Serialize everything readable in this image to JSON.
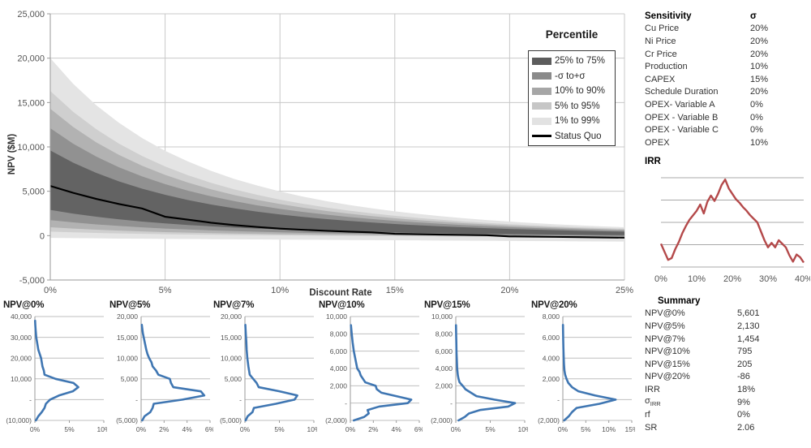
{
  "main_chart": {
    "ylabel": "NPV ($M)",
    "xlabel": "Discount Rate",
    "y_ticks": [
      "25,000",
      "20,000",
      "15,000",
      "10,000",
      "5,000",
      "0",
      "-5,000"
    ],
    "x_ticks": [
      "0%",
      "5%",
      "10%",
      "15%",
      "20%",
      "25%"
    ],
    "legend_title": "Percentile",
    "legend": [
      {
        "label": "25% to 75%",
        "color": "#5c5c5c",
        "type": "band"
      },
      {
        "label": "-σ to+σ",
        "color": "#8a8a8a",
        "type": "band"
      },
      {
        "label": "10% to 90%",
        "color": "#a6a6a6",
        "type": "band"
      },
      {
        "label": "5% to 95%",
        "color": "#c6c6c6",
        "type": "band"
      },
      {
        "label": "1% to 99%",
        "color": "#e2e2e2",
        "type": "band"
      },
      {
        "label": "Status Quo",
        "color": "#000000",
        "type": "line"
      }
    ]
  },
  "chart_data": [
    {
      "type": "area",
      "id": "npv-fan-chart",
      "title": "",
      "xlabel": "Discount Rate",
      "ylabel": "NPV ($M)",
      "xlim": [
        0,
        25
      ],
      "ylim": [
        -5000,
        25000
      ],
      "grid": true,
      "legend_position": "top-right",
      "x": [
        0,
        1,
        2,
        3,
        4,
        5,
        6,
        7,
        8,
        9,
        10,
        11,
        12,
        13,
        14,
        15,
        16,
        17,
        18,
        19,
        20,
        21,
        22,
        23,
        24,
        25
      ],
      "series": [
        {
          "name": "Status Quo",
          "values": [
            5601,
            4820,
            4140,
            3560,
            3060,
            2130,
            1800,
            1454,
            1190,
            980,
            795,
            660,
            545,
            450,
            370,
            205,
            160,
            120,
            85,
            50,
            -86,
            -110,
            -140,
            -170,
            -200,
            -230
          ]
        },
        {
          "name": "99%",
          "values": [
            20000,
            17100,
            14700,
            12700,
            11000,
            9550,
            8350,
            7300,
            6400,
            5650,
            4980,
            4400,
            3900,
            3460,
            3080,
            2740,
            2450,
            2190,
            1960,
            1760,
            1580,
            1420,
            1280,
            1160,
            1050,
            950
          ]
        },
        {
          "name": "95%",
          "values": [
            16300,
            13950,
            12000,
            10350,
            8970,
            7790,
            6800,
            5950,
            5220,
            4600,
            4060,
            3590,
            3180,
            2820,
            2510,
            2240,
            2000,
            1790,
            1600,
            1440,
            1290,
            1160,
            1050,
            950,
            860,
            780
          ]
        },
        {
          "name": "90%",
          "values": [
            14300,
            12240,
            10520,
            9080,
            7870,
            6840,
            5970,
            5220,
            4580,
            4030,
            3560,
            3150,
            2790,
            2480,
            2200,
            1960,
            1750,
            1570,
            1400,
            1260,
            1130,
            1020,
            920,
            830,
            750,
            680
          ]
        },
        {
          "name": "+sigma",
          "values": [
            12100,
            10360,
            8910,
            7690,
            6670,
            5800,
            5060,
            4430,
            3890,
            3420,
            3020,
            2670,
            2370,
            2100,
            1870,
            1660,
            1490,
            1330,
            1190,
            1070,
            960,
            860,
            780,
            700,
            630,
            570
          ]
        },
        {
          "name": "75%",
          "values": [
            9600,
            8220,
            7070,
            6100,
            5290,
            4600,
            4010,
            3510,
            3080,
            2710,
            2390,
            2110,
            1870,
            1660,
            1480,
            1310,
            1170,
            1050,
            940,
            840,
            750,
            680,
            610,
            550,
            490,
            440
          ]
        },
        {
          "name": "25%",
          "values": [
            2900,
            2480,
            2130,
            1840,
            1590,
            1380,
            1200,
            1050,
            910,
            800,
            700,
            610,
            540,
            470,
            410,
            360,
            310,
            270,
            230,
            200,
            170,
            140,
            110,
            90,
            70,
            50
          ]
        },
        {
          "name": "-sigma",
          "values": [
            1750,
            1490,
            1270,
            1090,
            930,
            800,
            690,
            590,
            510,
            440,
            370,
            320,
            270,
            230,
            190,
            160,
            130,
            100,
            80,
            60,
            40,
            20,
            0,
            -20,
            -40,
            -60
          ]
        },
        {
          "name": "10%",
          "values": [
            950,
            800,
            670,
            570,
            480,
            400,
            340,
            280,
            240,
            200,
            160,
            130,
            100,
            80,
            55,
            35,
            15,
            0,
            -15,
            -30,
            -45,
            -60,
            -75,
            -90,
            -105,
            -120
          ]
        },
        {
          "name": "5%",
          "values": [
            450,
            370,
            300,
            250,
            200,
            160,
            125,
            95,
            70,
            45,
            25,
            5,
            -10,
            -30,
            -45,
            -60,
            -75,
            -90,
            -105,
            -120,
            -135,
            -150,
            -165,
            -180,
            -195,
            -210
          ]
        },
        {
          "name": "1%",
          "values": [
            -250,
            -280,
            -305,
            -330,
            -350,
            -370,
            -385,
            -400,
            -415,
            -430,
            -445,
            -460,
            -475,
            -490,
            -505,
            -520,
            -535,
            -550,
            -565,
            -580,
            -595,
            -610,
            -625,
            -640,
            -655,
            -670
          ]
        }
      ]
    },
    {
      "type": "line",
      "id": "irr-distribution",
      "title": "IRR",
      "xlabel": "",
      "ylabel": "",
      "xlim": [
        0,
        40
      ],
      "ylim": [
        0,
        1
      ],
      "grid": true,
      "x_ticks": [
        "0%",
        "10%",
        "20%",
        "30%",
        "40%"
      ],
      "color": "#b4494a",
      "x": [
        0,
        1,
        2,
        3,
        4,
        5,
        6,
        7,
        8,
        9,
        10,
        11,
        12,
        13,
        14,
        15,
        16,
        17,
        18,
        19,
        20,
        21,
        22,
        23,
        24,
        25,
        26,
        27,
        28,
        29,
        30,
        31,
        32,
        33,
        34,
        35,
        36,
        37,
        38,
        39,
        40
      ],
      "values": [
        0.26,
        0.17,
        0.08,
        0.1,
        0.2,
        0.28,
        0.38,
        0.46,
        0.53,
        0.58,
        0.63,
        0.7,
        0.6,
        0.73,
        0.8,
        0.74,
        0.82,
        0.92,
        0.98,
        0.88,
        0.82,
        0.76,
        0.72,
        0.67,
        0.63,
        0.58,
        0.54,
        0.5,
        0.4,
        0.3,
        0.22,
        0.27,
        0.22,
        0.3,
        0.26,
        0.22,
        0.13,
        0.06,
        0.14,
        0.11,
        0.05
      ]
    },
    {
      "type": "line",
      "id": "npv-at-0-histogram",
      "title": "NPV@0%",
      "orientation": "horizontal",
      "x_ticks": [
        "0%",
        "5%",
        "10%"
      ],
      "y_ticks": [
        "40,000",
        "30,000",
        "20,000",
        "10,000",
        "-",
        "(10,000)"
      ],
      "xlim": [
        0,
        10
      ],
      "ylim": [
        -10000,
        40000
      ],
      "color": "#3f76b2",
      "bins": [
        -10000,
        -8000,
        -6000,
        -4000,
        -2000,
        0,
        2000,
        4000,
        6000,
        8000,
        10000,
        12000,
        14000,
        16000,
        18000,
        20000,
        22000,
        24000,
        26000,
        28000,
        30000,
        32000,
        34000,
        36000,
        38000
      ],
      "freq": [
        0.15,
        0.5,
        1.0,
        1.4,
        1.6,
        2.2,
        3.5,
        5.5,
        6.3,
        5.6,
        3.0,
        1.4,
        1.3,
        1.1,
        1.0,
        0.9,
        0.7,
        0.5,
        0.4,
        0.3,
        0.2,
        0.15,
        0.1,
        0.06,
        0.03
      ]
    },
    {
      "type": "line",
      "id": "npv-at-5-histogram",
      "title": "NPV@5%",
      "orientation": "horizontal",
      "x_ticks": [
        "0%",
        "2%",
        "4%",
        "6%"
      ],
      "y_ticks": [
        "20,000",
        "15,000",
        "10,000",
        "5,000",
        "-",
        "(5,000)"
      ],
      "xlim": [
        0,
        6
      ],
      "ylim": [
        -5000,
        20000
      ],
      "color": "#3f76b2",
      "bins": [
        -5000,
        -4000,
        -3000,
        -2000,
        -1000,
        0,
        1000,
        2000,
        3000,
        4000,
        5000,
        6000,
        7000,
        8000,
        9000,
        10000,
        11000,
        12000,
        14000,
        16000,
        18000
      ],
      "freq": [
        0.1,
        0.3,
        0.8,
        1.0,
        1.1,
        3.6,
        5.5,
        5.2,
        2.8,
        2.6,
        2.5,
        1.5,
        1.3,
        1.0,
        0.9,
        0.7,
        0.55,
        0.45,
        0.3,
        0.15,
        0.06
      ]
    },
    {
      "type": "line",
      "id": "npv-at-7-histogram",
      "title": "NPV@7%",
      "orientation": "horizontal",
      "x_ticks": [
        "0%",
        "5%",
        "10%"
      ],
      "y_ticks": [
        "20,000",
        "15,000",
        "10,000",
        "5,000",
        "-",
        "(5,000)"
      ],
      "xlim": [
        0,
        10
      ],
      "ylim": [
        -5000,
        20000
      ],
      "color": "#3f76b2",
      "bins": [
        -5000,
        -4000,
        -3000,
        -2000,
        -1000,
        0,
        1000,
        2000,
        3000,
        4000,
        5000,
        6000,
        7000,
        8000,
        10000,
        12000,
        14000,
        16000,
        18000
      ],
      "freq": [
        0.1,
        0.4,
        1.1,
        1.3,
        4.5,
        7.2,
        7.6,
        5.0,
        2.0,
        1.7,
        1.2,
        0.7,
        0.6,
        0.5,
        0.35,
        0.25,
        0.2,
        0.12,
        0.06
      ]
    },
    {
      "type": "line",
      "id": "npv-at-10-histogram",
      "title": "NPV@10%",
      "orientation": "horizontal",
      "x_ticks": [
        "0%",
        "2%",
        "4%",
        "6%"
      ],
      "y_ticks": [
        "10,000",
        "8,000",
        "6,000",
        "4,000",
        "2,000",
        "-",
        "(2,000)"
      ],
      "xlim": [
        0,
        6
      ],
      "ylim": [
        -2000,
        10000
      ],
      "color": "#3f76b2",
      "bins": [
        -2000,
        -1600,
        -1200,
        -800,
        -400,
        0,
        400,
        800,
        1200,
        1600,
        2000,
        2400,
        2800,
        3200,
        3600,
        4000,
        5000,
        6000,
        7000,
        8000,
        9000
      ],
      "freq": [
        0.3,
        1.2,
        1.6,
        1.5,
        2.5,
        5.0,
        5.3,
        4.0,
        2.7,
        2.3,
        2.2,
        1.3,
        1.1,
        0.9,
        0.8,
        0.6,
        0.45,
        0.3,
        0.2,
        0.12,
        0.05
      ]
    },
    {
      "type": "line",
      "id": "npv-at-15-histogram",
      "title": "NPV@15%",
      "orientation": "horizontal",
      "x_ticks": [
        "0%",
        "5%",
        "10%"
      ],
      "y_ticks": [
        "10,000",
        "8,000",
        "6,000",
        "4,000",
        "2,000",
        "-",
        "(2,000)"
      ],
      "xlim": [
        0,
        10
      ],
      "ylim": [
        -2000,
        10000
      ],
      "color": "#3f76b2",
      "bins": [
        -2000,
        -1600,
        -1200,
        -800,
        -400,
        0,
        400,
        800,
        1200,
        1600,
        2000,
        2400,
        2800,
        3200,
        4000,
        5000,
        6000,
        7000,
        8000,
        9000
      ],
      "freq": [
        0.4,
        1.3,
        1.9,
        3.5,
        7.6,
        8.6,
        5.6,
        3.0,
        2.2,
        1.4,
        1.0,
        0.55,
        0.4,
        0.3,
        0.2,
        0.15,
        0.1,
        0.08,
        0.05,
        0.03
      ]
    },
    {
      "type": "line",
      "id": "npv-at-20-histogram",
      "title": "NPV@20%",
      "orientation": "horizontal",
      "x_ticks": [
        "0%",
        "5%",
        "10%",
        "15%"
      ],
      "y_ticks": [
        "8,000",
        "6,000",
        "4,000",
        "2,000",
        "-",
        "(2,000)"
      ],
      "xlim": [
        0,
        15
      ],
      "ylim": [
        -2000,
        8000
      ],
      "color": "#3f76b2",
      "bins": [
        -2000,
        -1600,
        -1200,
        -800,
        -400,
        0,
        400,
        800,
        1200,
        1600,
        2000,
        2400,
        2800,
        3400,
        4200,
        5000,
        5800,
        6600,
        7200
      ],
      "freq": [
        0.3,
        1.3,
        2.0,
        3.0,
        8.0,
        11.5,
        7.0,
        3.4,
        2.0,
        1.2,
        0.8,
        0.5,
        0.35,
        0.25,
        0.18,
        0.12,
        0.08,
        0.05,
        0.03
      ]
    }
  ],
  "sensitivity": {
    "header": {
      "name": "Sensitivity",
      "value": "σ"
    },
    "rows": [
      {
        "name": "Cu Price",
        "value": "20%"
      },
      {
        "name": "Ni Price",
        "value": "20%"
      },
      {
        "name": "Cr Price",
        "value": "20%"
      },
      {
        "name": "Production",
        "value": "10%"
      },
      {
        "name": "CAPEX",
        "value": "15%"
      },
      {
        "name": "Schedule Duration",
        "value": "20%"
      },
      {
        "name": "OPEX- Variable A",
        "value": "0%"
      },
      {
        "name": "OPEX - Variable B",
        "value": "0%"
      },
      {
        "name": "OPEX - Variable C",
        "value": "0%"
      },
      {
        "name": "OPEX",
        "value": "10%"
      }
    ],
    "footer": "IRR"
  },
  "summary": {
    "header": "Summary",
    "rows": [
      {
        "name": "NPV@0%",
        "value": "5,601"
      },
      {
        "name": "NPV@5%",
        "value": "2,130"
      },
      {
        "name": "NPV@7%",
        "value": "1,454"
      },
      {
        "name": "NPV@10%",
        "value": "795"
      },
      {
        "name": "NPV@15%",
        "value": "205"
      },
      {
        "name": "NPV@20%",
        "value": "-86"
      },
      {
        "name": "IRR",
        "value": "18%"
      },
      {
        "name": "σIRR",
        "value": "9%"
      },
      {
        "name": "rf",
        "value": "0%"
      },
      {
        "name": "SR",
        "value": "2.06"
      }
    ]
  },
  "colors": {
    "band_darkest": "#5c5c5c",
    "band_dark": "#8a8a8a",
    "band_mid": "#a6a6a6",
    "band_light": "#c6c6c6",
    "band_lightest": "#e2e2e2",
    "status_quo_line": "#000000",
    "irr_line": "#b4494a",
    "histogram_line": "#3f76b2",
    "grid": "#c8c8c8"
  }
}
